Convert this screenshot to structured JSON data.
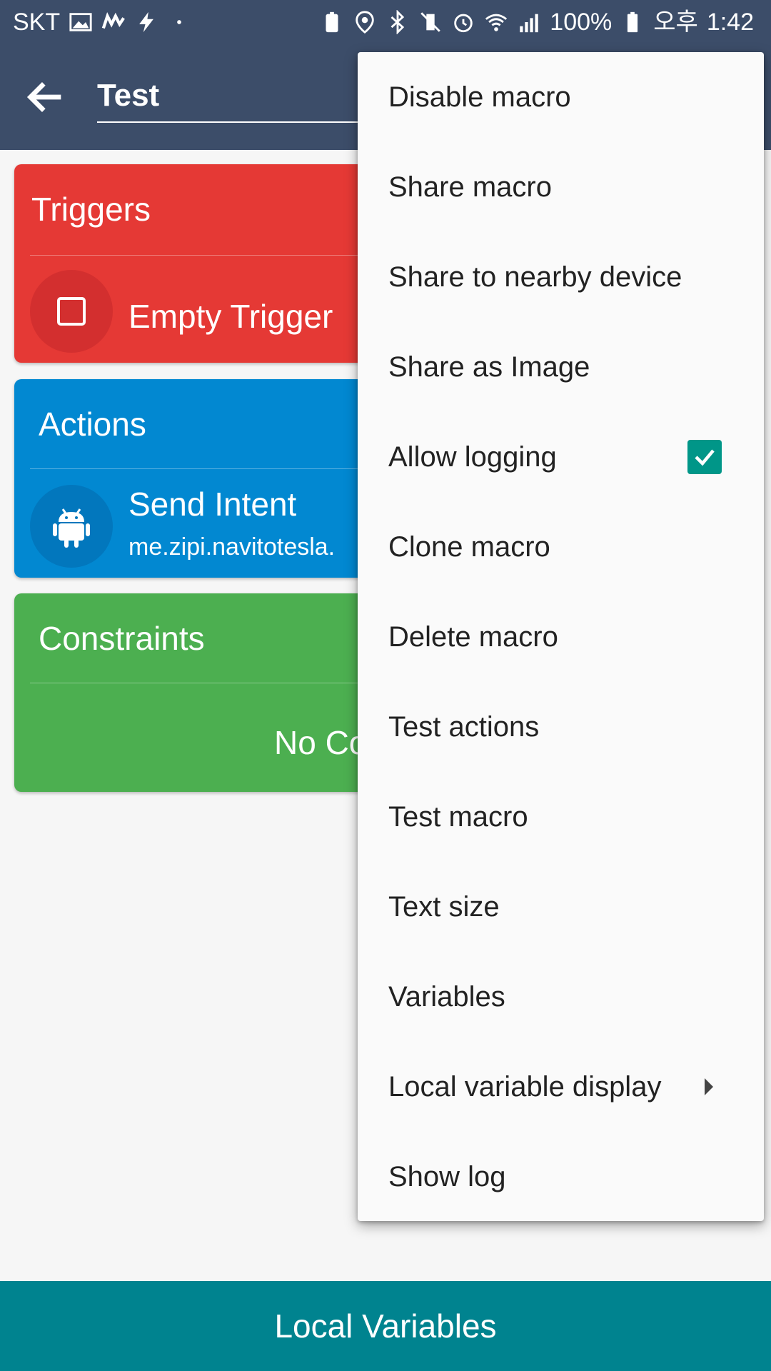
{
  "status_bar": {
    "carrier": "SKT",
    "battery_percent": "100%",
    "ampm": "오후",
    "time": "1:42"
  },
  "app_bar": {
    "title": "Test"
  },
  "triggers": {
    "header": "Triggers",
    "item_title": "Empty Trigger"
  },
  "actions": {
    "header": "Actions",
    "item_title": "Send Intent",
    "item_subtitle": "me.zipi.navitotesla."
  },
  "constraints": {
    "header": "Constraints",
    "empty_text_partial": "No Co"
  },
  "menu": {
    "items": [
      {
        "label": "Disable macro"
      },
      {
        "label": "Share macro"
      },
      {
        "label": "Share to nearby device"
      },
      {
        "label": "Share as Image"
      },
      {
        "label": "Allow logging",
        "checked": true
      },
      {
        "label": "Clone macro"
      },
      {
        "label": "Delete macro"
      },
      {
        "label": "Test actions"
      },
      {
        "label": "Test macro"
      },
      {
        "label": "Text size"
      },
      {
        "label": "Variables"
      },
      {
        "label": "Local variable display",
        "has_submenu": true
      },
      {
        "label": "Show log"
      }
    ]
  },
  "bottom_bar": {
    "label": "Local Variables"
  },
  "colors": {
    "app_bar": "#3c4d69",
    "triggers": "#e53935",
    "actions": "#0288d1",
    "constraints": "#4caf50",
    "bottom_bar": "#00838f",
    "checkbox": "#009688"
  }
}
